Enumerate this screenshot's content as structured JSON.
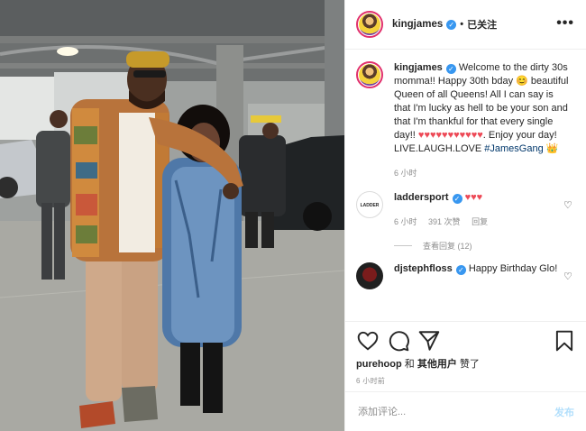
{
  "post": {
    "username": "kingjames",
    "follow_state": "已关注",
    "more": "•••"
  },
  "caption": {
    "username": "kingjames",
    "text_1": "Welcome to the dirty 30s momma!! Happy 30th bday",
    "emoji_1": "😊",
    "text_2": "beautiful Queen of all Queens! All I can say is that I'm lucky as hell to be your son and that I'm thankful for that every single day!!",
    "hearts": "♥♥♥♥♥♥♥♥♥♥♥",
    "text_3": ". Enjoy your day! LIVE.LAUGH.LOVE",
    "hashtag": "#JamesGang",
    "crown": "👑",
    "time": "6 小时"
  },
  "comments": [
    {
      "username": "laddersport",
      "text": "♥♥♥",
      "time": "6 小时",
      "likes": "391 次赞",
      "reply": "回复",
      "view_replies": "查看回复 (12)"
    },
    {
      "username": "djstephfloss",
      "text": "Happy Birthday Glo!"
    }
  ],
  "footer": {
    "liked_by_user": "purehoop",
    "and": "和",
    "others": "其他用户",
    "liked": "赞了",
    "time": "6 小时前",
    "comment_placeholder": "添加评论...",
    "post_button": "发布"
  },
  "colors": {
    "verified": "#3897f0",
    "heart": "#ed4956",
    "hashtag": "#00376b",
    "post_button_disabled": "#b2dffc"
  },
  "icons": [
    "like-icon",
    "comment-icon",
    "share-icon",
    "save-icon",
    "verified-icon",
    "more-icon"
  ]
}
